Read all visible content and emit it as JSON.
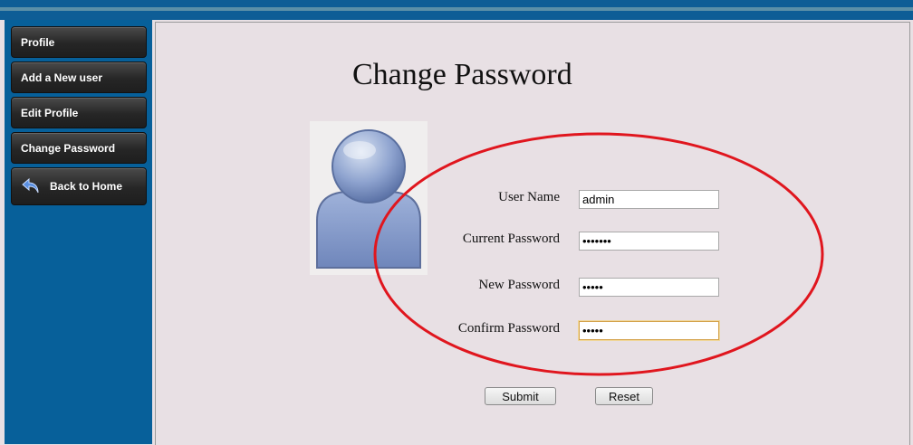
{
  "sidebar": {
    "items": [
      {
        "label": "Profile"
      },
      {
        "label": "Add a New user"
      },
      {
        "label": "Edit Profile"
      },
      {
        "label": "Change Password"
      },
      {
        "label": "Back to Home",
        "icon": "back-arrow-icon"
      }
    ]
  },
  "main": {
    "title": "Change Password",
    "avatar_icon": "user-avatar-icon",
    "form": {
      "username_label": "User Name",
      "username_value": "admin",
      "current_password_label": "Current Password",
      "current_password_value": "•••••••",
      "new_password_label": "New Password",
      "new_password_value": "•••••",
      "confirm_password_label": "Confirm Password",
      "confirm_password_value": "•••••"
    },
    "submit_label": "Submit",
    "reset_label": "Reset"
  },
  "colors": {
    "topbar": "#0e5d96",
    "sidebar": "#07609a",
    "content_bg": "#e8e0e4",
    "annotation": "#e0161e"
  }
}
